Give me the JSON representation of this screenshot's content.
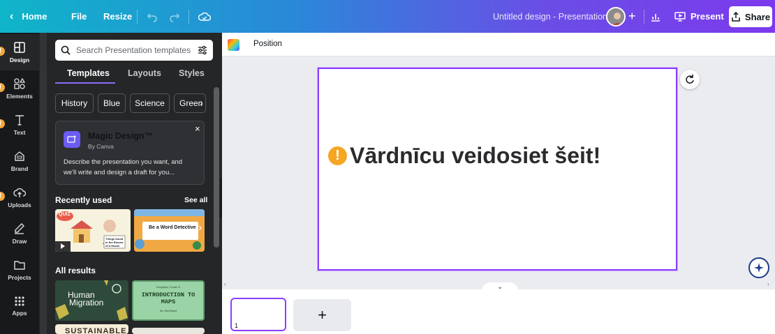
{
  "topbar": {
    "home": "Home",
    "file": "File",
    "resize": "Resize",
    "doc_title": "Untitled design - Presentation",
    "present": "Present",
    "share": "Share"
  },
  "rail": [
    {
      "label": "Design",
      "icon": "layout-icon",
      "warn": true
    },
    {
      "label": "Elements",
      "icon": "shapes-icon",
      "warn": true
    },
    {
      "label": "Text",
      "icon": "text-icon",
      "warn": true
    },
    {
      "label": "Brand",
      "icon": "brand-icon",
      "warn": false
    },
    {
      "label": "Uploads",
      "icon": "upload-cloud-icon",
      "warn": true
    },
    {
      "label": "Draw",
      "icon": "pen-icon",
      "warn": false
    },
    {
      "label": "Projects",
      "icon": "folder-icon",
      "warn": false
    },
    {
      "label": "Apps",
      "icon": "apps-grid-icon",
      "warn": false
    }
  ],
  "panel": {
    "search_placeholder": "Search Presentation templates",
    "tabs": [
      "Templates",
      "Layouts",
      "Styles"
    ],
    "chips": [
      "History",
      "Blue",
      "Science",
      "Green"
    ],
    "magic": {
      "title": "Magic Design™",
      "by": "By Canva",
      "desc": "Describe the presentation you want, and we'll write and design a draft for you..."
    },
    "recently_used": "Recently used",
    "see_all": "See all",
    "all_results": "All results",
    "thumb_texts": {
      "quiz": "QUIZ",
      "house_caption": "Things found in the Rooms of a House",
      "detective": "Be a Word Detective",
      "human": "Human",
      "migration": "Migration",
      "maps_small": "Geography | Grade 11",
      "maps_title": "INTRODUCTION TO MAPS",
      "maps_sub": "Ms. Eliot Bryant",
      "sustainable": "SUSTAINABLE"
    }
  },
  "editor": {
    "position": "Position",
    "slide_text": "Vārdnīcu veidosiet šeit!",
    "warn_glyph": "!",
    "page_number": "1",
    "add_page": "+"
  },
  "colors": {
    "accent": "#8b3dff",
    "warning": "#f5a623",
    "panel_bg": "#252627",
    "rail_bg": "#18191b"
  }
}
